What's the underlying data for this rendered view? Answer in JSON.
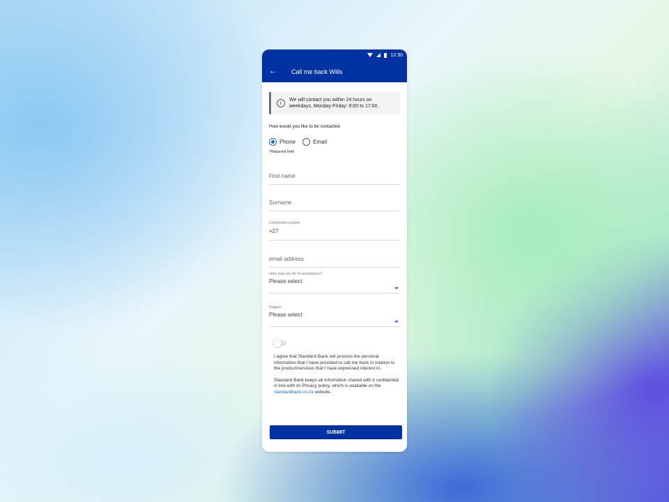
{
  "status_bar": {
    "time": "12:30"
  },
  "app_bar": {
    "title": "Call me back Wills"
  },
  "notice": {
    "text": "We will contact you within 24 hours on weekdays, Monday-Friday: 8:00 to 17:00."
  },
  "contact_method": {
    "label": "How would you like to be contacted",
    "options": [
      {
        "label": "Phone",
        "selected": true
      },
      {
        "label": "Email",
        "selected": false
      }
    ]
  },
  "required_note": "*Required field",
  "fields": {
    "first_name": {
      "placeholder": "First name"
    },
    "surname": {
      "placeholder": "Surname"
    },
    "cellphone": {
      "label": "Cellphone number",
      "value": "+27"
    },
    "email": {
      "placeholder": "email address"
    },
    "assistance": {
      "label": "How may we be of assistance?",
      "value": "Please select"
    },
    "region": {
      "label": "Region",
      "value": "Please select"
    }
  },
  "consent": {
    "toggle_on": false,
    "agreement": "I agree that Standard Bank will process the personal information that I have provided to call me back in relation to the product/services that I have expressed interest in.",
    "privacy_prefix": "Standard Bank keeps all information shared with it confidential in line with its Privacy policy, which is available on the",
    "privacy_link": "standardbank.co.za",
    "privacy_suffix": "website."
  },
  "submit_label": "SUBMIT",
  "colors": {
    "brand": "#0033a1",
    "accent": "#1966d2"
  },
  "icons": {
    "back": "arrow-left-icon",
    "info": "info-icon",
    "dropdown": "caret-down-icon"
  }
}
